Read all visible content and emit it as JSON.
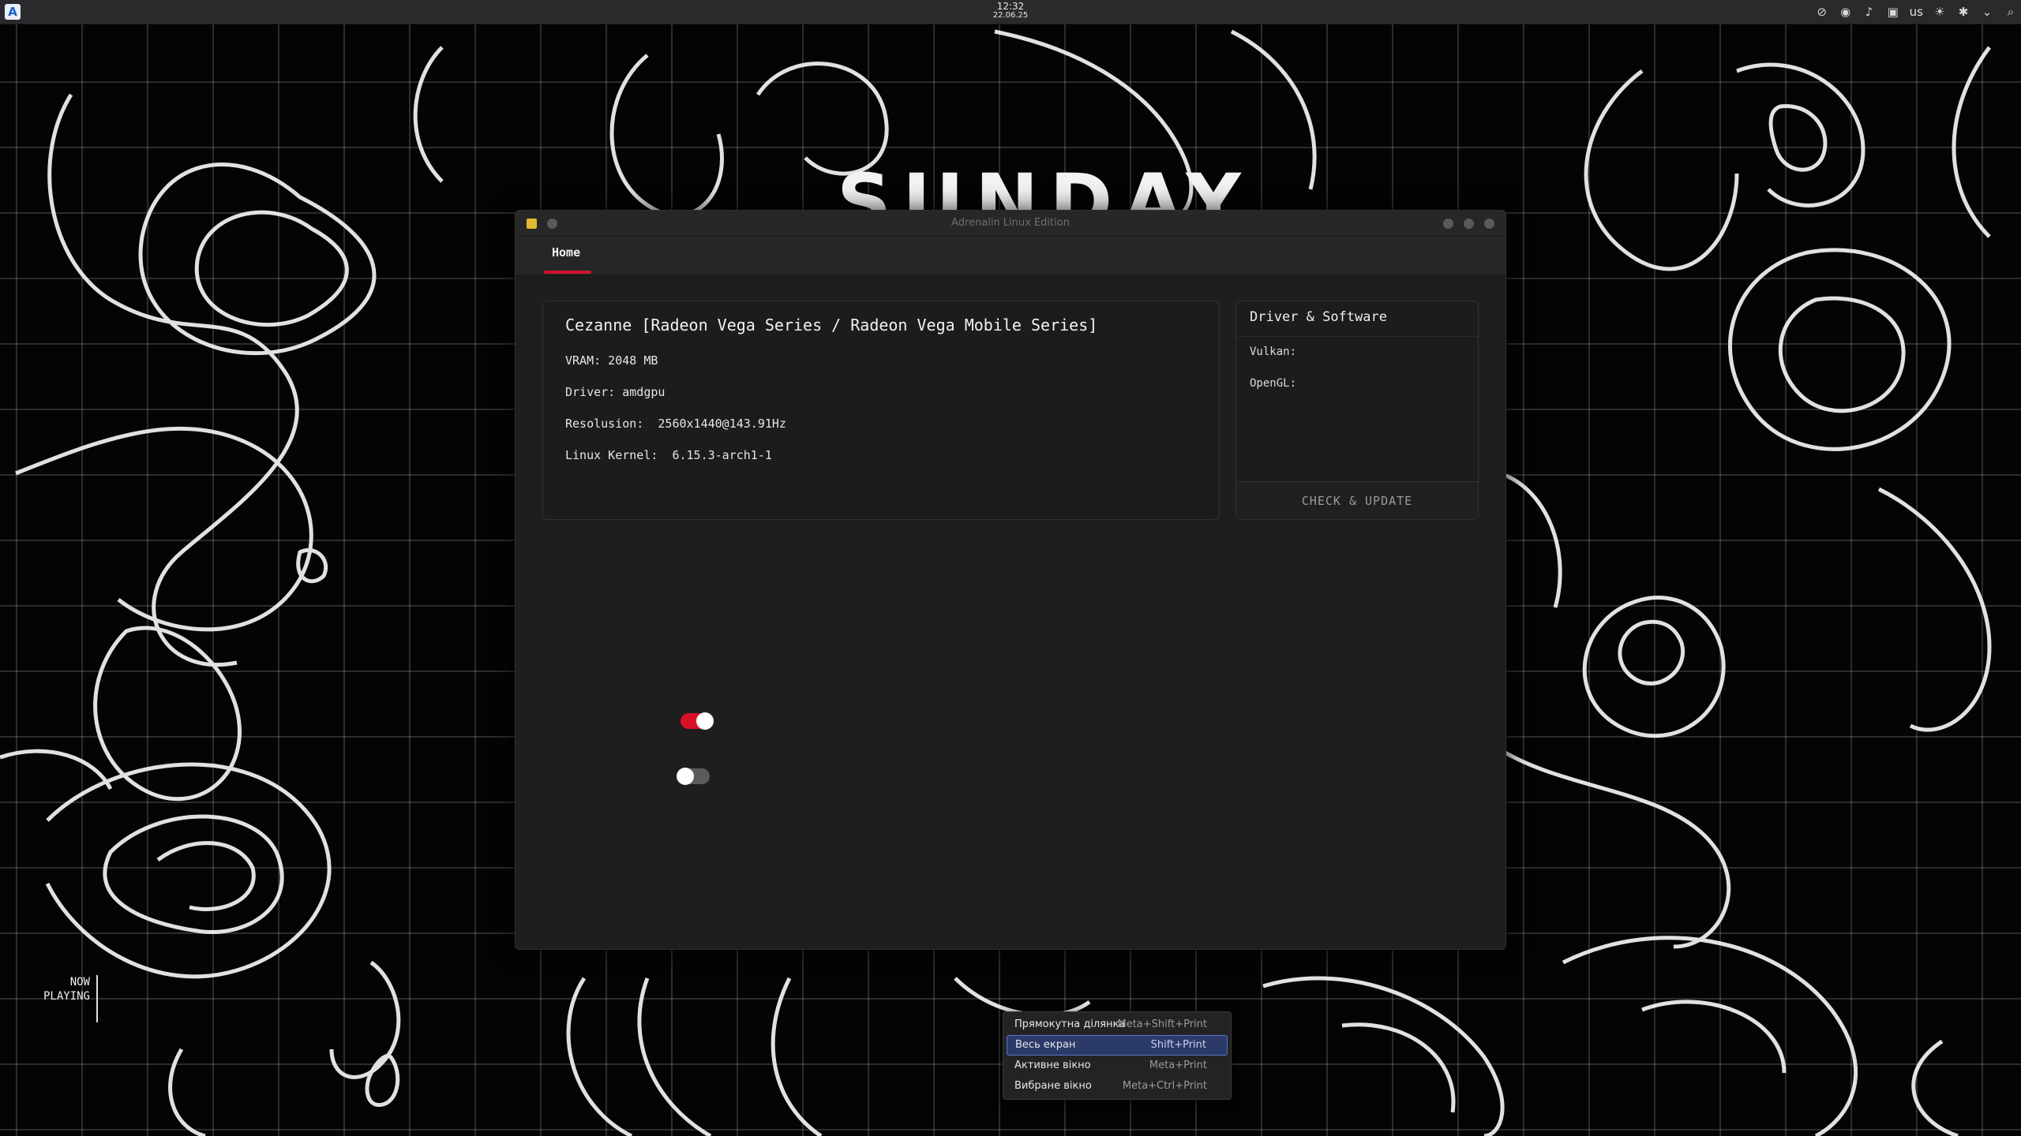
{
  "topbar": {
    "launcher_glyph": "A",
    "time": "12:32",
    "date": "22.06.25",
    "keyboard_layout": "us",
    "tray_icons": [
      "network-off-icon",
      "discord-icon",
      "volume-icon",
      "clipboard-icon",
      "brightness-icon",
      "bluetooth-icon",
      "tray-expand-icon",
      "search-icon"
    ]
  },
  "wallpaper": {
    "text": "SUNDAY"
  },
  "window": {
    "title": "Adrenalin Linux Edition",
    "tabs": [
      {
        "label": "Home",
        "active": true
      }
    ],
    "accent_color": "#d2142f",
    "gpu": {
      "name": "Cezanne [Radeon Vega Series / Radeon Vega Mobile Series]",
      "vram": "VRAM: 2048 MB",
      "driver": "Driver: amdgpu",
      "resolution": "Resolusion:  2560x1440@143.91Hz",
      "kernel": "Linux Kernel:  6.15.3-arch1-1"
    },
    "driver_card": {
      "title": "Driver & Software",
      "vulkan": "Vulkan:",
      "opengl": "OpenGL:",
      "button": "CHECK & UPDATE"
    },
    "toggles": [
      {
        "state": "on"
      },
      {
        "state": "off"
      }
    ]
  },
  "now_playing": {
    "line1": "NOW",
    "line2": "PLAYING"
  },
  "screenshot_menu": {
    "items": [
      {
        "label": "Прямокутна ділянка",
        "shortcut": "Meta+Shift+Print"
      },
      {
        "label": "Весь екран",
        "shortcut": "Shift+Print",
        "highlighted": true
      },
      {
        "label": "Активне вікно",
        "shortcut": "Meta+Print"
      },
      {
        "label": "Вибране вікно",
        "shortcut": "Meta+Ctrl+Print"
      }
    ]
  }
}
